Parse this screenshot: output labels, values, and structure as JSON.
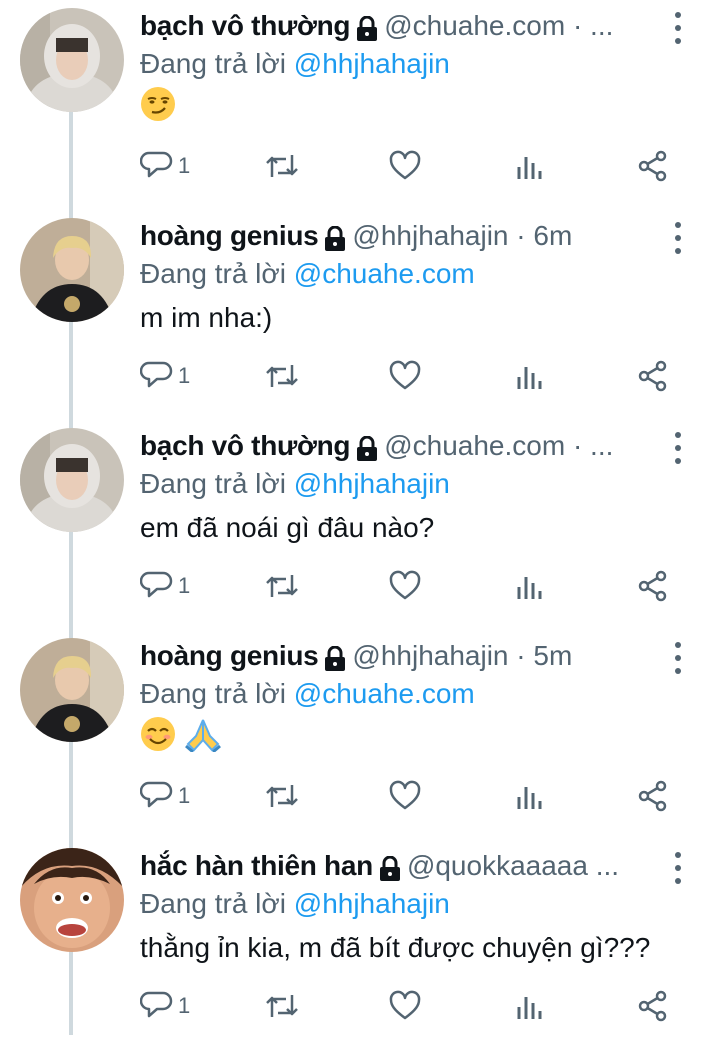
{
  "colors": {
    "text_primary": "#0f1419",
    "text_secondary": "#536471",
    "mention": "#1d9bf0",
    "thread_line": "#cfd9de",
    "background": "#ffffff"
  },
  "tweets": [
    {
      "name": "bạch vô thường",
      "handle": "@chuahe.com · ...",
      "reply_prefix": "Đang trả lời",
      "reply_to": "@hhjhahajin",
      "text": "",
      "emoji": [
        "smirk"
      ],
      "reply_count": "1",
      "avatar": "avatar-hoodie"
    },
    {
      "name": "hoàng genius",
      "handle": "@hhjhahajin · 6m",
      "reply_prefix": "Đang trả lời",
      "reply_to": "@chuahe.com",
      "text": "m im nha:)",
      "emoji": [],
      "reply_count": "1",
      "avatar": "avatar-blond"
    },
    {
      "name": "bạch vô thường",
      "handle": "@chuahe.com · ...",
      "reply_prefix": "Đang trả lời",
      "reply_to": "@hhjhahajin",
      "text": "em đã noái gì đâu nào?",
      "emoji": [],
      "reply_count": "1",
      "avatar": "avatar-hoodie"
    },
    {
      "name": "hoàng genius",
      "handle": "@hhjhahajin · 5m",
      "reply_prefix": "Đang trả lời",
      "reply_to": "@chuahe.com",
      "text": "",
      "emoji": [
        "smiling-face",
        "folded-hands"
      ],
      "reply_count": "1",
      "avatar": "avatar-blond"
    },
    {
      "name": "hắc hàn thiên han",
      "handle": "@quokkaaaaa ...",
      "reply_prefix": "Đang trả lời",
      "reply_to": "@hhjhahajin",
      "text": "thằng ỉn kia, m đã bít được chuyện gì???",
      "emoji": [],
      "reply_count": "1",
      "avatar": "avatar-face"
    }
  ],
  "icons": {
    "reply": "reply-icon",
    "retweet": "retweet-icon",
    "like": "heart-icon",
    "views": "views-icon",
    "share": "share-icon",
    "lock": "lock-icon",
    "more": "more-icon"
  }
}
